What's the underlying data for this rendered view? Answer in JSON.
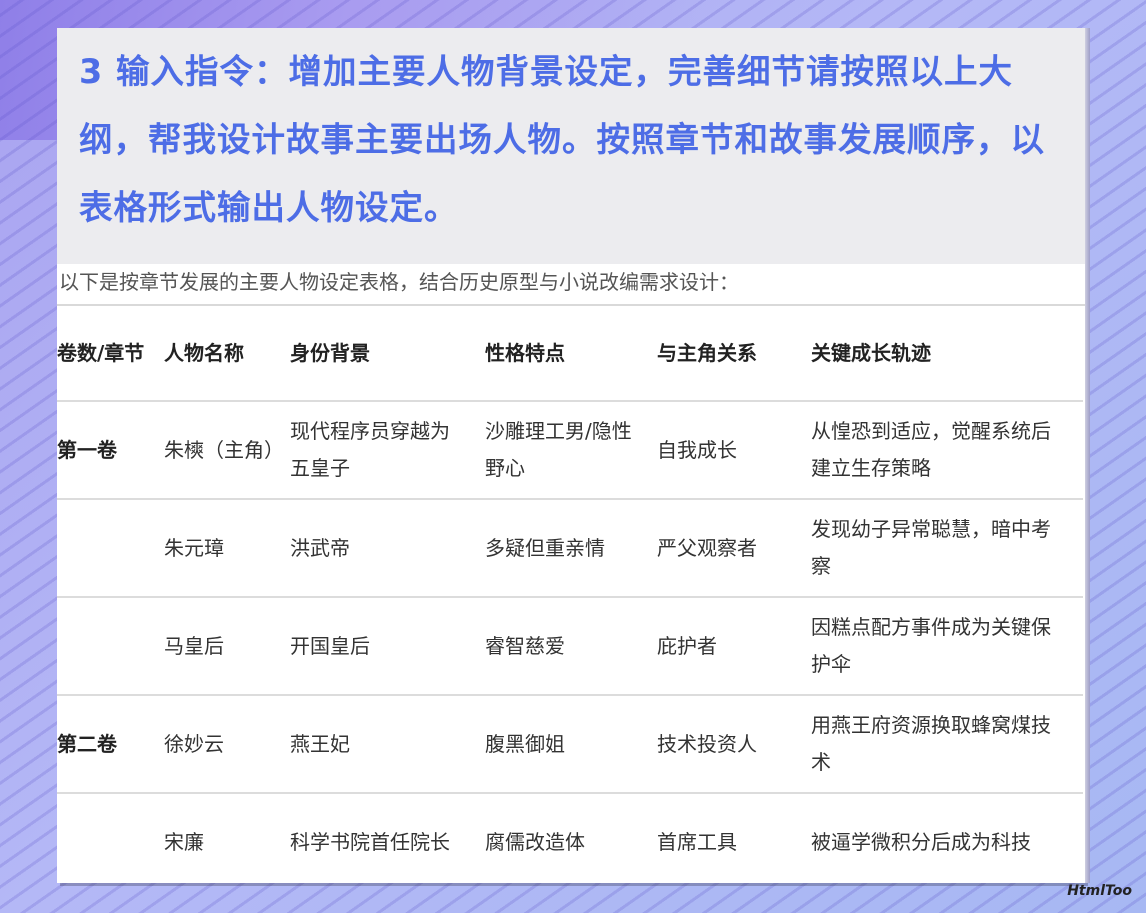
{
  "instruction": {
    "text": "3  输入指令：增加主要人物背景设定，完善细节请按照以上大纲，帮我设计故事主要出场人物。按照章节和故事发展顺序，以表格形式输出人物设定。"
  },
  "intro": "以下是按章节发展的主要人物设定表格，结合历史原型与小说改编需求设计：",
  "table": {
    "headers": [
      "卷数/章节",
      "人物名称",
      "身份背景",
      "性格特点",
      "与主角关系",
      "关键成长轨迹"
    ],
    "rows": [
      [
        "第一卷",
        "朱樉（主角）",
        "现代程序员穿越为五皇子",
        "沙雕理工男/隐性野心",
        "自我成长",
        "从惶恐到适应，觉醒系统后建立生存策略"
      ],
      [
        "",
        "朱元璋",
        "洪武帝",
        "多疑但重亲情",
        "严父观察者",
        "发现幼子异常聪慧，暗中考察"
      ],
      [
        "",
        "马皇后",
        "开国皇后",
        "睿智慈爱",
        "庇护者",
        "因糕点配方事件成为关键保护伞"
      ],
      [
        "第二卷",
        "徐妙云",
        "燕王妃",
        "腹黑御姐",
        "技术投资人",
        "用燕王府资源换取蜂窝煤技术"
      ],
      [
        "",
        "宋廉",
        "科学书院首任院长",
        "腐儒改造体",
        "首席工具",
        "被逼学微积分后成为科技"
      ]
    ]
  },
  "watermark": "HtmlToo"
}
